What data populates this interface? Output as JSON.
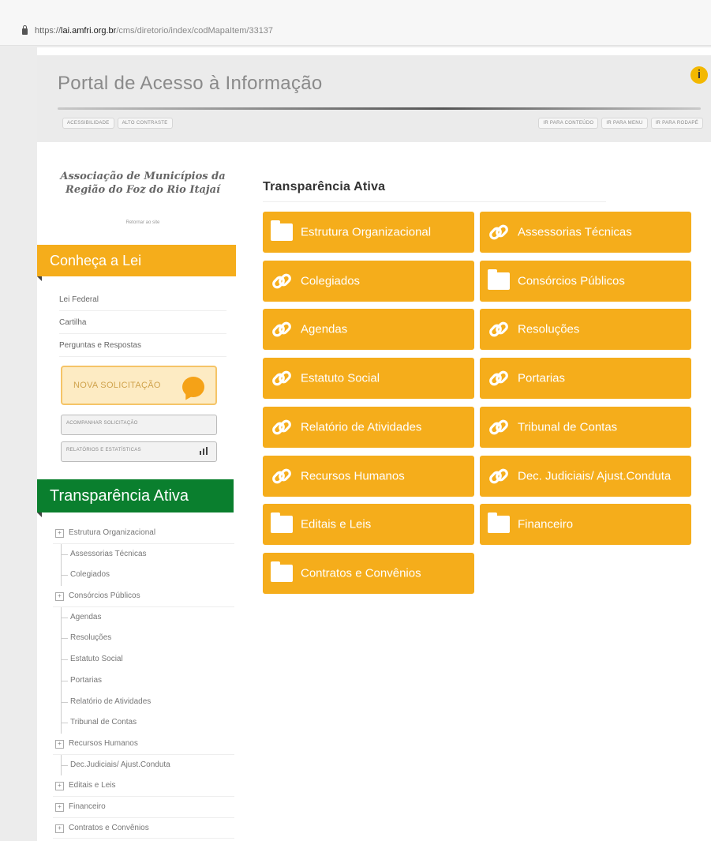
{
  "browser": {
    "url_host_prefix": "https://",
    "url_host": "lai.amfri.org.br",
    "url_path": "/cms/diretorio/index/codMapaItem/33137"
  },
  "header": {
    "title": "Portal de Acesso à Informação",
    "info_icon_glyph": "i",
    "accessibility_links": [
      "ACESSIBILIDADE",
      "ALTO CONTRASTE"
    ],
    "skip_links": [
      "IR PARA CONTEÚDO",
      "IR PARA MENU",
      "IR PARA RODAPÉ"
    ]
  },
  "sidebar": {
    "org_name": "Associação de Municípios da Região do Foz do Rio Itajaí",
    "org_sub": "Retornar ao site",
    "law_heading": "Conheça a Lei",
    "law_items": [
      "Lei Federal",
      "Cartilha",
      "Perguntas e Respostas"
    ],
    "nova_solicitacao": "NOVA SOLICITAÇÃO",
    "acompanhar": "ACOMPANHAR SOLICITAÇÃO",
    "relatorios": "RELATÓRIOS E ESTATÍSTICAS",
    "transparencia_heading": "Transparência Ativa",
    "tree": [
      {
        "label": "Estrutura Organizacional",
        "type": "lvl"
      },
      {
        "label": "Assessorias Técnicas",
        "type": "leaf"
      },
      {
        "label": "Colegiados",
        "type": "leaf"
      },
      {
        "label": "Consórcios Públicos",
        "type": "lvl"
      },
      {
        "label": "Agendas",
        "type": "leaf"
      },
      {
        "label": "Resoluções",
        "type": "leaf"
      },
      {
        "label": "Estatuto Social",
        "type": "leaf"
      },
      {
        "label": "Portarias",
        "type": "leaf"
      },
      {
        "label": "Relatório de Atividades",
        "type": "leaf"
      },
      {
        "label": "Tribunal de Contas",
        "type": "leaf"
      },
      {
        "label": "Recursos Humanos",
        "type": "lvl"
      },
      {
        "label": "Dec.Judiciais/ Ajust.Conduta",
        "type": "leaf"
      },
      {
        "label": "Editais e Leis",
        "type": "lvl"
      },
      {
        "label": "Financeiro",
        "type": "lvl"
      },
      {
        "label": "Contratos e Convênios",
        "type": "lvl"
      }
    ]
  },
  "main": {
    "title": "Transparência Ativa",
    "tiles": [
      {
        "label": "Estrutura Organizacional",
        "icon": "folder-icon"
      },
      {
        "label": "Assessorias Técnicas",
        "icon": "link-icon"
      },
      {
        "label": "Colegiados",
        "icon": "link-icon"
      },
      {
        "label": "Consórcios Públicos",
        "icon": "folder-icon"
      },
      {
        "label": "Agendas",
        "icon": "link-icon"
      },
      {
        "label": "Resoluções",
        "icon": "link-icon"
      },
      {
        "label": "Estatuto Social",
        "icon": "link-icon"
      },
      {
        "label": "Portarias",
        "icon": "link-icon"
      },
      {
        "label": "Relatório de Atividades",
        "icon": "link-icon"
      },
      {
        "label": "Tribunal de Contas",
        "icon": "link-icon"
      },
      {
        "label": "Recursos Humanos",
        "icon": "link-icon"
      },
      {
        "label": "Dec. Judiciais/ Ajust.Conduta",
        "icon": "link-icon"
      },
      {
        "label": "Editais e Leis",
        "icon": "folder-icon"
      },
      {
        "label": "Financeiro",
        "icon": "folder-icon"
      },
      {
        "label": "Contratos e Convênios",
        "icon": "folder-icon"
      }
    ]
  },
  "colors": {
    "tile": "#f5ad1b",
    "ribbon_yellow": "#f5ad1b",
    "ribbon_green": "#0a7f2e"
  }
}
